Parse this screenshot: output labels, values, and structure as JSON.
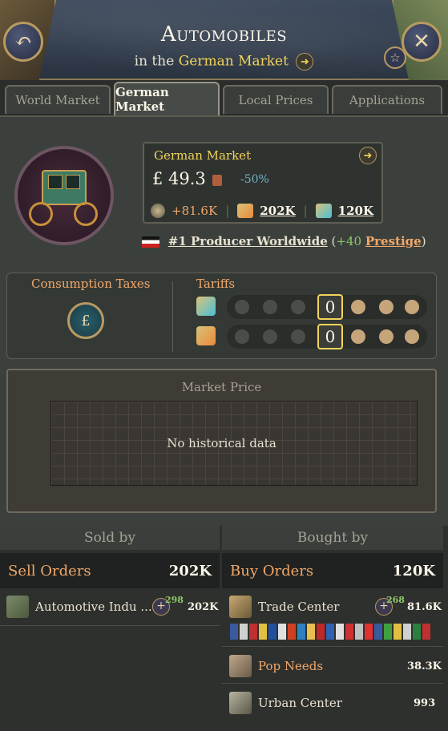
{
  "header": {
    "title": "Automobiles",
    "subtitle_prefix": "in the",
    "subtitle_market": "German Market"
  },
  "tabs": [
    {
      "label": "World Market",
      "active": false
    },
    {
      "label": "German Market",
      "active": true
    },
    {
      "label": "Local Prices",
      "active": false
    },
    {
      "label": "Applications",
      "active": false
    }
  ],
  "info": {
    "market_name": "German Market",
    "price": "£ 49.3",
    "price_pct": "-50%",
    "balance": "+81.6K",
    "sell_volume": "202K",
    "buy_volume": "120K"
  },
  "producer": {
    "rank_text": "#1 Producer Worldwide",
    "open": "(",
    "prestige_value": "+40",
    "prestige_label": "Prestige",
    "close": ")"
  },
  "taxes": {
    "consumption_label": "Consumption Taxes",
    "tariffs_label": "Tariffs",
    "import_value": "0",
    "export_value": "0"
  },
  "market_price": {
    "title": "Market Price",
    "empty_text": "No historical data"
  },
  "sold_by": {
    "header": "Sold by",
    "orders_label": "Sell Orders",
    "orders_total": "202K",
    "rows": [
      {
        "name": "Automotive Indu ...",
        "badge": "298",
        "amount": "202K"
      }
    ]
  },
  "bought_by": {
    "header": "Bought by",
    "orders_label": "Buy Orders",
    "orders_total": "120K",
    "rows": [
      {
        "name": "Trade Center",
        "badge": "268",
        "amount": "81.6K"
      },
      {
        "name": "Pop Needs",
        "amount": "38.3K"
      },
      {
        "name": "Urban Center",
        "amount": "993"
      }
    ]
  },
  "colors": {
    "accent_gold": "#f2d35a",
    "accent_orange": "#f2a86a",
    "positive": "#8ec96a",
    "info_blue": "#6fb2c9"
  }
}
